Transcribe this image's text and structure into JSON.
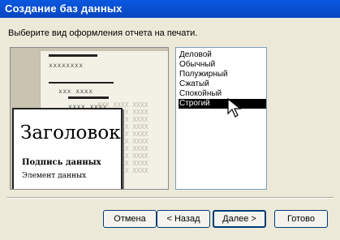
{
  "window": {
    "title": "Создание баз данных"
  },
  "instruction": "Выберите вид оформления отчета на печати.",
  "preview": {
    "heading": "Заголовок",
    "subtitle": "Подпись данных",
    "element": "Элемент данных",
    "x_row_1": "xxxxxxxx",
    "x_row_2": "xxx xxxx",
    "x_row_3": "xxxx xxxx",
    "grid_text": "XXX XXXX XXXX\nXXX XXXX XXXX\nXXX XXXX XXXX\nXXX XXXX XXXX\nXXX XXXX XXXX\nXXX XXXX XXXX\nXXX XXXX XXXX\nXXX XXXX XXXX\nXXX XXXX XXXX\nXXX XXXX XXXX"
  },
  "styles": {
    "items": [
      "Деловой",
      "Обычный",
      "Полужирный",
      "Сжатый",
      "Спокойный",
      "Строгий"
    ],
    "selected": "Строгий"
  },
  "buttons": {
    "cancel": "Отмена",
    "back": "< Назад",
    "next": "Далее >",
    "finish": "Готово"
  },
  "colors": {
    "titlebar": "#0a58e0",
    "selection": "#000000",
    "background": "#ece9d8"
  }
}
